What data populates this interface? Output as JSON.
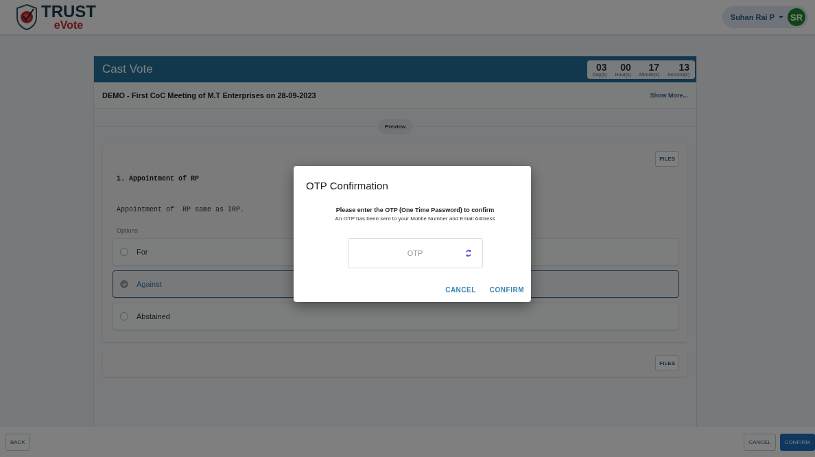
{
  "header": {
    "logo_title": "TRUST",
    "logo_subtitle": "eVote",
    "user": {
      "name": "Suhan Rai P",
      "initials": "SR"
    }
  },
  "panel": {
    "title": "Cast Vote",
    "countdown": [
      {
        "value": "03",
        "unit": "Day(s)"
      },
      {
        "value": "00",
        "unit": "Hour(s)"
      },
      {
        "value": "17",
        "unit": "Minute(s)"
      },
      {
        "value": "13",
        "unit": "Second(s)"
      }
    ],
    "meeting": "DEMO - First CoC Meeting of M.T Enterprises on 28-09-2023",
    "show_more": "Show More...",
    "preview": "Preview"
  },
  "resolutions": [
    {
      "files": "FILES",
      "title": "1. Appointment of RP",
      "description": "Appointment of  RP same as IRP.",
      "options_label": "Options",
      "options": [
        {
          "label": "For",
          "selected": false
        },
        {
          "label": "Against",
          "selected": true
        },
        {
          "label": "Abstained",
          "selected": false
        }
      ]
    },
    {
      "files": "FILES"
    }
  ],
  "footer": {
    "back": "BACK",
    "cancel": "CANCEL",
    "confirm": "CONFIRM"
  },
  "dialog": {
    "title": "OTP Confirmation",
    "instruction": "Please enter the OTP (One Time Password) to confirm",
    "note": "An OTP has been sent to your Mobile Number and Email Address",
    "otp": {
      "placeholder": "OTP"
    },
    "buttons": [
      "CANCEL",
      "CONFIRM"
    ]
  }
}
